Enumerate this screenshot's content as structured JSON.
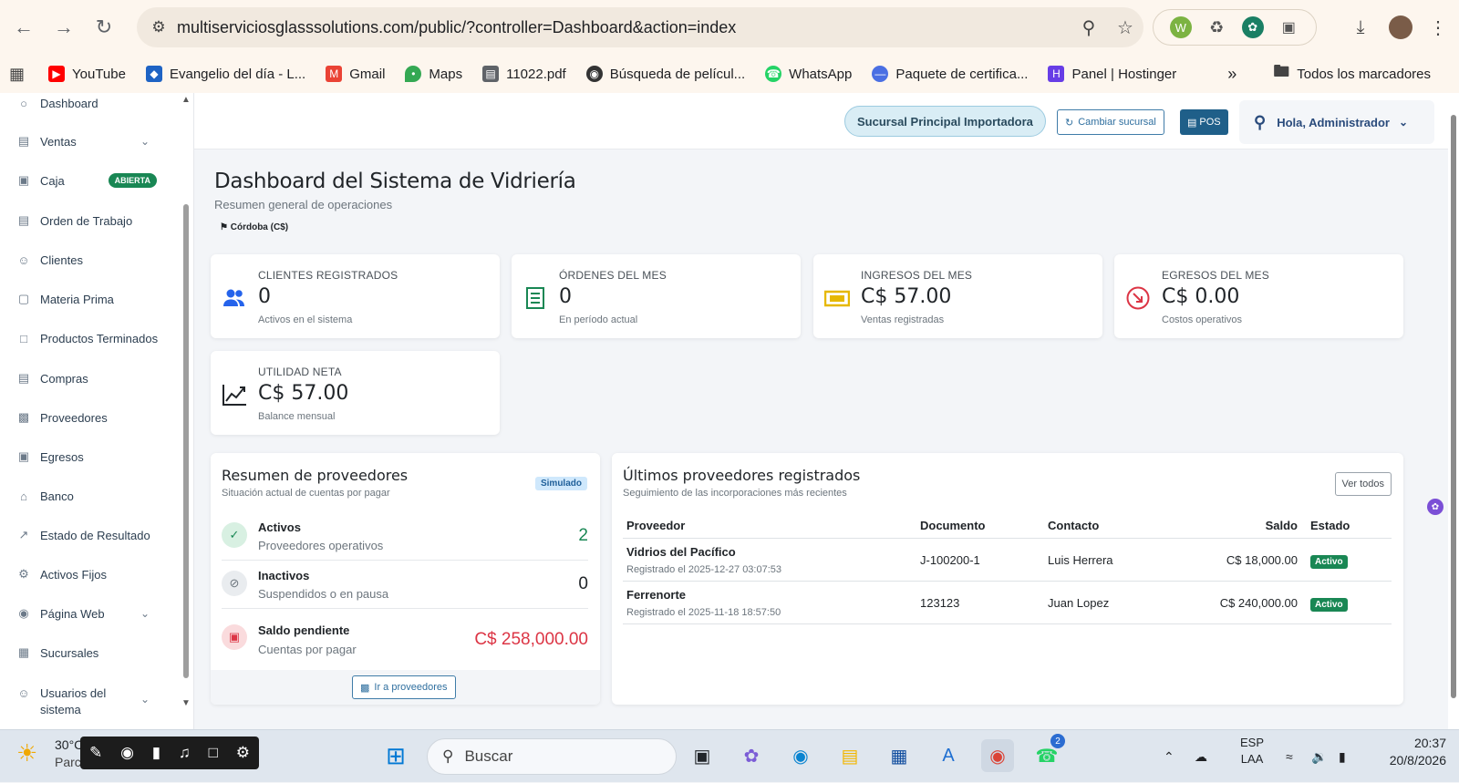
{
  "browser": {
    "url": "multiserviciosglasssolutions.com/public/?controller=Dashboard&action=index",
    "bookmarks": [
      "YouTube",
      "Evangelio del día - L...",
      "Gmail",
      "Maps",
      "11022.pdf",
      "Búsqueda de películ...",
      "WhatsApp",
      "Paquete de certifica...",
      "Panel | Hostinger"
    ],
    "more_bookmarks": "»",
    "all_bookmarks": "Todos los marcadores"
  },
  "sidebar": {
    "items": [
      {
        "label": "Dashboard",
        "icon": "dashboard-icon"
      },
      {
        "label": "Ventas",
        "icon": "cart-icon",
        "chevron": true
      },
      {
        "label": "Caja",
        "icon": "cash-icon",
        "badge": "ABIERTA"
      },
      {
        "label": "Orden de Trabajo",
        "icon": "clipboard-icon"
      },
      {
        "label": "Clientes",
        "icon": "users-icon"
      },
      {
        "label": "Materia Prima",
        "icon": "box-icon"
      },
      {
        "label": "Productos Terminados",
        "icon": "frame-icon"
      },
      {
        "label": "Compras",
        "icon": "cart-icon"
      },
      {
        "label": "Proveedores",
        "icon": "truck-icon"
      },
      {
        "label": "Egresos",
        "icon": "wallet-icon"
      },
      {
        "label": "Banco",
        "icon": "bank-icon"
      },
      {
        "label": "Estado de Resultado",
        "icon": "chart-icon"
      },
      {
        "label": "Activos Fijos",
        "icon": "gear-icon"
      },
      {
        "label": "Página Web",
        "icon": "globe-icon",
        "chevron": true
      },
      {
        "label": "Sucursales",
        "icon": "building-icon"
      },
      {
        "label": "Usuarios del sistema",
        "icon": "users-icon",
        "chevron": true
      }
    ]
  },
  "topbar": {
    "branch": "Sucursal Principal Importadora",
    "change_branch": "Cambiar sucursal",
    "pos": "POS",
    "greeting": "Hola, Administrador"
  },
  "page": {
    "title": "Dashboard del Sistema de Vidriería",
    "subtitle": "Resumen general de operaciones",
    "currency": "Córdoba (C$)"
  },
  "stats": [
    {
      "label": "CLIENTES REGISTRADOS",
      "value": "0",
      "sub": "Activos en el sistema",
      "icon": "users-icon",
      "color": "#2563eb"
    },
    {
      "label": "ÓRDENES DEL MES",
      "value": "0",
      "sub": "En período actual",
      "icon": "receipt-icon",
      "color": "#198754"
    },
    {
      "label": "INGRESOS DEL MES",
      "value": "C$ 57.00",
      "sub": "Ventas registradas",
      "icon": "cash-icon",
      "color": "#e6b800"
    },
    {
      "label": "EGRESOS DEL MES",
      "value": "C$ 0.00",
      "sub": "Costos operativos",
      "icon": "arrow-down-right-icon",
      "color": "#dc3545"
    },
    {
      "label": "UTILIDAD NETA",
      "value": "C$ 57.00",
      "sub": "Balance mensual",
      "icon": "trend-up-icon",
      "color": "#212529"
    }
  ],
  "suppliers_summary": {
    "title": "Resumen de proveedores",
    "subtitle": "Situación actual de cuentas por pagar",
    "badge": "Simulado",
    "rows": [
      {
        "title": "Activos",
        "sub": "Proveedores operativos",
        "value": "2",
        "color": "#198754"
      },
      {
        "title": "Inactivos",
        "sub": "Suspendidos o en pausa",
        "value": "0",
        "color": "#212529"
      },
      {
        "title": "Saldo pendiente",
        "sub": "Cuentas por pagar",
        "value": "C$ 258,000.00",
        "color": "#dc3545"
      }
    ],
    "button": "Ir a proveedores"
  },
  "latest_suppliers": {
    "title": "Últimos proveedores registrados",
    "subtitle": "Seguimiento de las incorporaciones más recientes",
    "button": "Ver todos",
    "columns": [
      "Proveedor",
      "Documento",
      "Contacto",
      "Saldo",
      "Estado"
    ],
    "rows": [
      {
        "name": "Vidrios del Pacífico",
        "registered": "Registrado el 2025-12-27 03:07:53",
        "document": "J-100200-1",
        "contact": "Luis Herrera",
        "balance": "C$ 18,000.00",
        "status": "Activo"
      },
      {
        "name": "Ferrenorte",
        "registered": "Registrado el 2025-11-18 18:57:50",
        "document": "123123",
        "contact": "Juan Lopez",
        "balance": "C$ 240,000.00",
        "status": "Activo"
      }
    ]
  },
  "taskbar": {
    "weather_temp": "30°C",
    "weather_desc": "Parcialmente",
    "search": "Buscar",
    "whatsapp_badge": "2",
    "lang1": "ESP",
    "lang2": "LAA",
    "time": "20:37",
    "date": "20/8/2026"
  }
}
